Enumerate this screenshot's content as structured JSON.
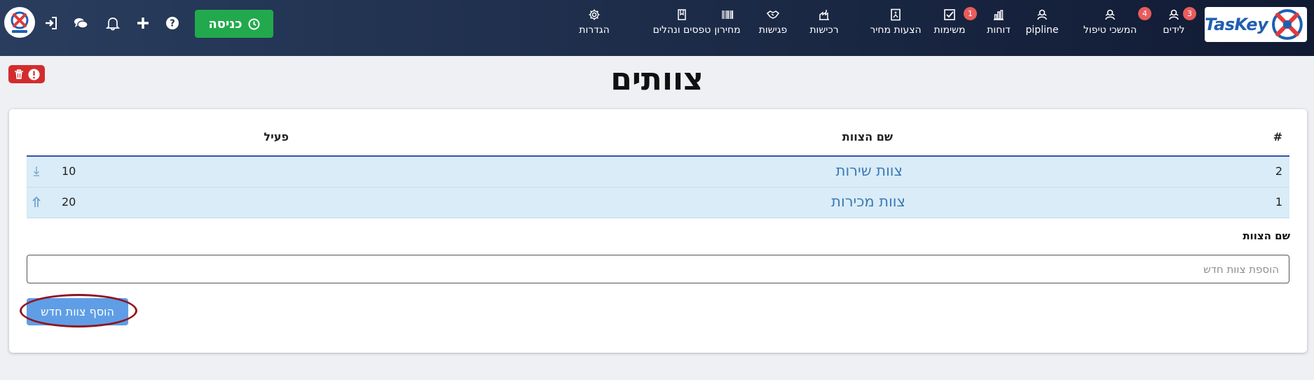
{
  "brand": {
    "name": "TasKey"
  },
  "nav": [
    {
      "label": "לידים",
      "icon": "leads-icon",
      "badge": "3"
    },
    {
      "label": "המשכי טיפול",
      "icon": "followups-icon",
      "badge": "4"
    },
    {
      "label": "pipline",
      "icon": "pipeline-icon",
      "badge": ""
    },
    {
      "label": "דוחות",
      "icon": "reports-icon",
      "badge": ""
    },
    {
      "label": "משימות",
      "icon": "tasks-icon",
      "badge": "1"
    },
    {
      "label": "הצעות מחיר",
      "icon": "quotes-icon",
      "badge": ""
    },
    {
      "label": "רכישות",
      "icon": "purchases-icon",
      "badge": ""
    },
    {
      "label": "פגישות",
      "icon": "meetings-icon",
      "badge": ""
    },
    {
      "label": "מחירון",
      "icon": "pricelist-icon",
      "badge": ""
    },
    {
      "label": "טפסים ונהלים",
      "icon": "forms-icon",
      "badge": ""
    },
    {
      "label": "הגדרות",
      "icon": "settings-icon",
      "badge": ""
    }
  ],
  "topbar": {
    "enter_label": "כניסה"
  },
  "page": {
    "title": "צוותים",
    "table": {
      "headers": {
        "index": "#",
        "name": "שם הצוות",
        "active": "פעיל"
      },
      "rows": [
        {
          "index": "2",
          "name": "צוות שירות",
          "active": "10"
        },
        {
          "index": "1",
          "name": "צוות מכירות",
          "active": "20"
        }
      ]
    },
    "form": {
      "label": "שם הצוות",
      "placeholder": "הוספת צוות חדש",
      "value": "",
      "submit_label": "הוסף צוות חדש"
    }
  },
  "colors": {
    "topbar": "#1e2e4b",
    "enter_button": "#22a94d",
    "badge": "#e85c5c",
    "row_background": "#d9ecf7",
    "link_text": "#3c7ab5",
    "primary_button": "#5f9ee6",
    "danger": "#d22d2d"
  }
}
